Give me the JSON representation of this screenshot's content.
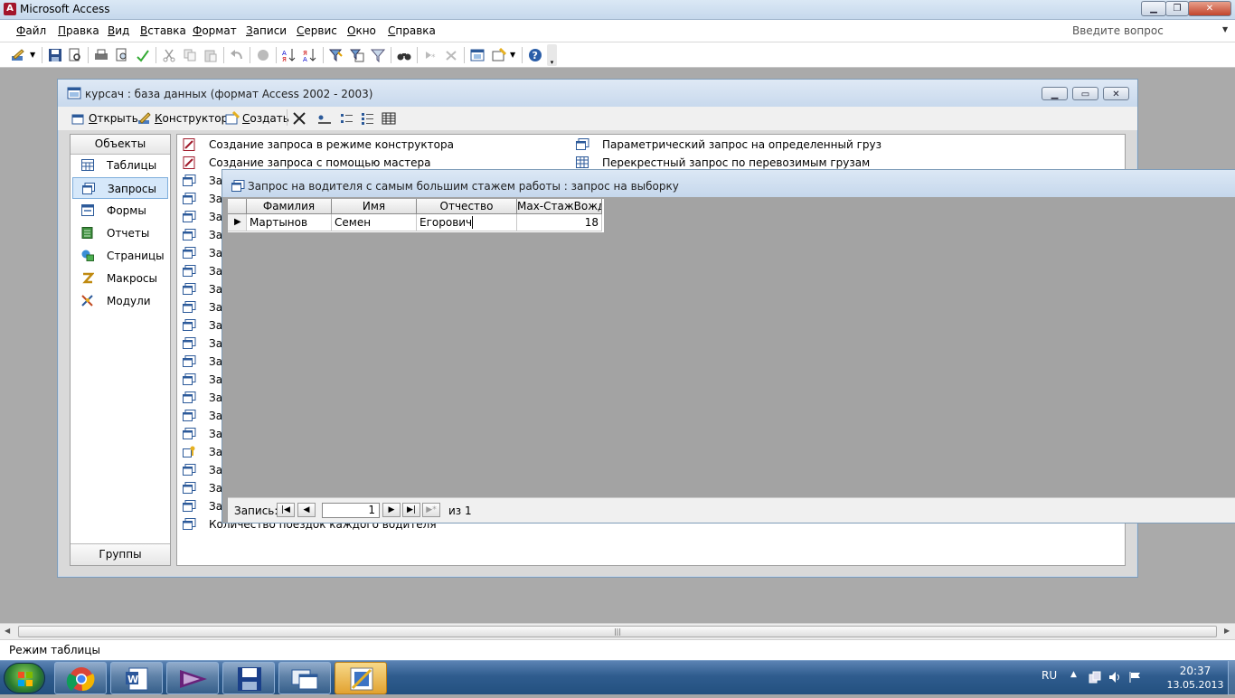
{
  "app": {
    "title": "Microsoft Access"
  },
  "menu": [
    "Файл",
    "Правка",
    "Вид",
    "Вставка",
    "Формат",
    "Записи",
    "Сервис",
    "Окно",
    "Справка"
  ],
  "ask_placeholder": "Введите вопрос",
  "db_window": {
    "title": "курсач : база данных (формат Access 2002 - 2003)",
    "toolbar": {
      "open": "Открыть",
      "design": "Конструктор",
      "create": "Создать"
    },
    "objects_header": "Объекты",
    "objects": [
      {
        "label": "Таблицы",
        "icon": "table-icon",
        "selected": false
      },
      {
        "label": "Запросы",
        "icon": "query-icon",
        "selected": true
      },
      {
        "label": "Формы",
        "icon": "form-icon",
        "selected": false
      },
      {
        "label": "Отчеты",
        "icon": "report-icon",
        "selected": false
      },
      {
        "label": "Страницы",
        "icon": "page-icon",
        "selected": false
      },
      {
        "label": "Макросы",
        "icon": "macro-icon",
        "selected": false
      },
      {
        "label": "Модули",
        "icon": "module-icon",
        "selected": false
      }
    ],
    "groups_label": "Группы",
    "list_left": [
      "Создание запроса в режиме конструктора",
      "Создание запроса с помощью мастера",
      "За",
      "За",
      "За",
      "За",
      "За",
      "За",
      "За",
      "За",
      "За",
      "За",
      "За",
      "За",
      "За",
      "За",
      "За",
      "За",
      "За",
      "За",
      "За",
      "Количество поездок каждого водителя"
    ],
    "list_right": [
      "Параметрический запрос на определенный груз",
      "Перекрестный запрос по перевозимым грузам"
    ]
  },
  "query_window": {
    "title": "Запрос на водителя с самым большим стажем работы : запрос на выборку",
    "columns": [
      "Фамилия",
      "Имя",
      "Отчество",
      "Max-СтажВожд"
    ],
    "rows": [
      [
        "Мартынов",
        "Семен",
        "Егорович",
        "18"
      ]
    ],
    "nav": {
      "record_label": "Запись:",
      "current": "1",
      "of_label": "из",
      "total": "1"
    }
  },
  "status": {
    "text": "Режим таблицы"
  },
  "tray": {
    "lang": "RU",
    "time": "20:37",
    "date": "13.05.2013"
  },
  "colors": {
    "title_gradient_top": "#dbe8f5",
    "selected_bg": "#d6e8fa",
    "taskbar": "#2f5c8e",
    "active_task": "#e2a230"
  }
}
